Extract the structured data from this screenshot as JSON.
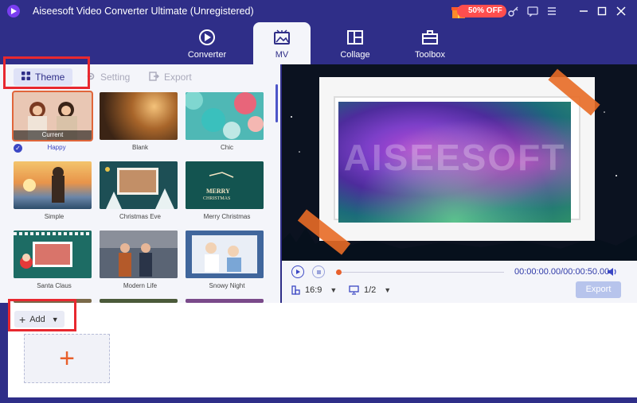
{
  "app": {
    "title": "Aiseesoft Video Converter Ultimate (Unregistered)",
    "promo_label": "50% OFF"
  },
  "nav_tabs": [
    {
      "label": "Converter",
      "icon": "converter-icon",
      "active": false
    },
    {
      "label": "MV",
      "icon": "mv-icon",
      "active": true
    },
    {
      "label": "Collage",
      "icon": "collage-icon",
      "active": false
    },
    {
      "label": "Toolbox",
      "icon": "toolbox-icon",
      "active": false
    }
  ],
  "subtabs": {
    "theme": "Theme",
    "setting": "Setting",
    "export": "Export"
  },
  "themes": [
    {
      "label": "Happy",
      "badge": "Current",
      "selected": true
    },
    {
      "label": "Blank"
    },
    {
      "label": "Chic"
    },
    {
      "label": "Simple"
    },
    {
      "label": "Christmas Eve"
    },
    {
      "label": "Merry Christmas"
    },
    {
      "label": "Santa Claus"
    },
    {
      "label": "Modern Life"
    },
    {
      "label": "Snowy Night"
    }
  ],
  "preview": {
    "watermark": "AISEESOFT"
  },
  "player": {
    "timecode": "00:00:00.00/00:00:50.00",
    "aspect_ratio": "16:9",
    "screen_ratio": "1/2",
    "export_label": "Export",
    "progress": 0
  },
  "media": {
    "add_label": "Add",
    "drop_plus": "+"
  },
  "colors": {
    "brand": "#2f2e88",
    "accent": "#3b47c4",
    "highlight": "#e8282f",
    "orange": "#e8602c"
  }
}
